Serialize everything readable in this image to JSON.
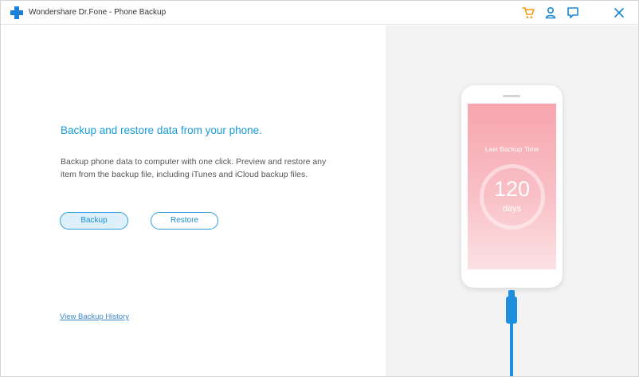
{
  "window": {
    "title": "Wondershare Dr.Fone - Phone Backup"
  },
  "titlebar": {
    "icons": [
      "cart-icon",
      "user-icon",
      "feedback-icon",
      "close-icon"
    ],
    "cart_color": "#f39c12",
    "icon_color": "#1a86d6"
  },
  "main": {
    "headline": "Backup and restore data from your phone.",
    "description": "Backup phone data to computer with one click. Preview and restore any item from the backup file, including iTunes and iCloud backup files.",
    "backup_label": "Backup",
    "restore_label": "Restore",
    "history_link": "View Backup History"
  },
  "phone": {
    "last_backup_label": "Last Backup Time",
    "days_value": "120",
    "days_unit": "days",
    "screen_color": "#f7a5ae",
    "cable_color": "#1d8fdc"
  }
}
